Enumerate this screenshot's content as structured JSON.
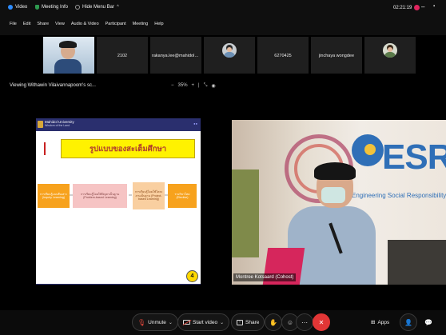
{
  "titlebar": {
    "app_label": "Video",
    "meeting_info": "Meeting Info",
    "hide_menu": "Hide Menu Bar",
    "clock": "02:21:19",
    "minimize": "–"
  },
  "menu": [
    "File",
    "Edit",
    "Share",
    "View",
    "Audio & Video",
    "Participant",
    "Meeting",
    "Help"
  ],
  "participants": [
    {
      "name": "",
      "type": "video"
    },
    {
      "name": "2102",
      "type": "name"
    },
    {
      "name": "rakanya.lee@mahidol.a...",
      "type": "name"
    },
    {
      "name": "",
      "type": "avatar"
    },
    {
      "name": "6270425",
      "type": "name"
    },
    {
      "name": "jinchaya wongdee",
      "type": "name"
    },
    {
      "name": "",
      "type": "avatar"
    }
  ],
  "viewbar": {
    "label": "Viewing Withawin Vilaivannapoom's sc...",
    "zoom_minus": "−",
    "zoom_level": "35%",
    "zoom_plus": "+",
    "separator": "|"
  },
  "slide": {
    "university": "Mahidol University",
    "university_sub": "Wisdom of the Land",
    "title": "รูปแบบของสะเต็มศึกษา",
    "boxes": [
      "การเรียนรู้แบบสืบเสาะ (Inquiry Learning)",
      "การเรียนรู้โดยใช้ปัญหาเป็นฐาน (Problem-based Learning)",
      "การเรียนรู้โดยใช้โครงงานเป็นฐาน (Project-based Learning)",
      "รายวิชาใหม่ (Elective)"
    ],
    "page": "4"
  },
  "video": {
    "brand": "ESR",
    "tagline": "Engineering Social Responsibility",
    "name": "Montree Kotsaard (Cohost)"
  },
  "toolbar": {
    "unmute": "Unmute",
    "start_video": "Start video",
    "share": "Share",
    "apps": "Apps"
  },
  "colors": {
    "background": "#000000",
    "end_call": "#e23636",
    "slide_title_bg": "#fff200",
    "muted_red": "#e0473b"
  }
}
